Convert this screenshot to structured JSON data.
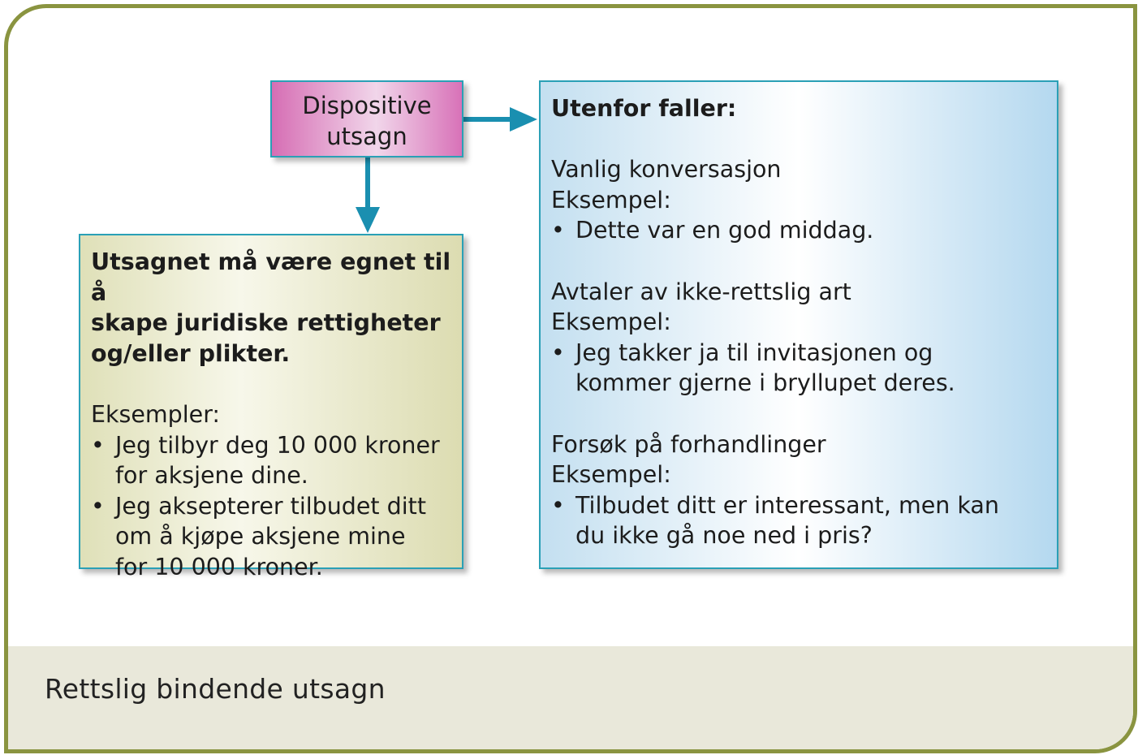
{
  "caption": "Rettslig bindende utsagn",
  "colors": {
    "frame": "#8a9440",
    "caption_band": "#e9e8da",
    "box_border": "#2aa0b6",
    "arrow": "#1a8fb0",
    "disp_fill": "#d66eb4",
    "left_fill": "#dfe0b8",
    "right_fill": "#c3dff0"
  },
  "disp_box": {
    "line1": "Dispositive",
    "line2": "utsagn"
  },
  "left_box": {
    "heading_lines": [
      "Utsagnet må være egnet til å",
      "skape juridiske rettigheter",
      "og/eller plikter."
    ],
    "examples_label": "Eksempler:",
    "bullet_glyph": "•",
    "items": [
      [
        "Jeg tilbyr deg 10 000 kroner",
        "for aksjene dine."
      ],
      [
        "Jeg aksepterer tilbudet ditt",
        "om å kjøpe aksjene mine",
        "for 10 000 kroner."
      ]
    ]
  },
  "right_box": {
    "heading": "Utenfor faller:",
    "bullet_glyph": "•",
    "sections": [
      {
        "title": "Vanlig konversasjon",
        "label": "Eksempel:",
        "bullet_lines": [
          "Dette var en god middag."
        ]
      },
      {
        "title": "Avtaler av ikke-rettslig art",
        "label": "Eksempel:",
        "bullet_lines": [
          "Jeg takker ja til invitasjonen og",
          "kommer gjerne i bryllupet deres."
        ]
      },
      {
        "title": "Forsøk på forhandlinger",
        "label": "Eksempel:",
        "bullet_lines": [
          "Tilbudet ditt er interessant, men kan",
          "du ikke gå noe ned i pris?"
        ]
      }
    ]
  }
}
